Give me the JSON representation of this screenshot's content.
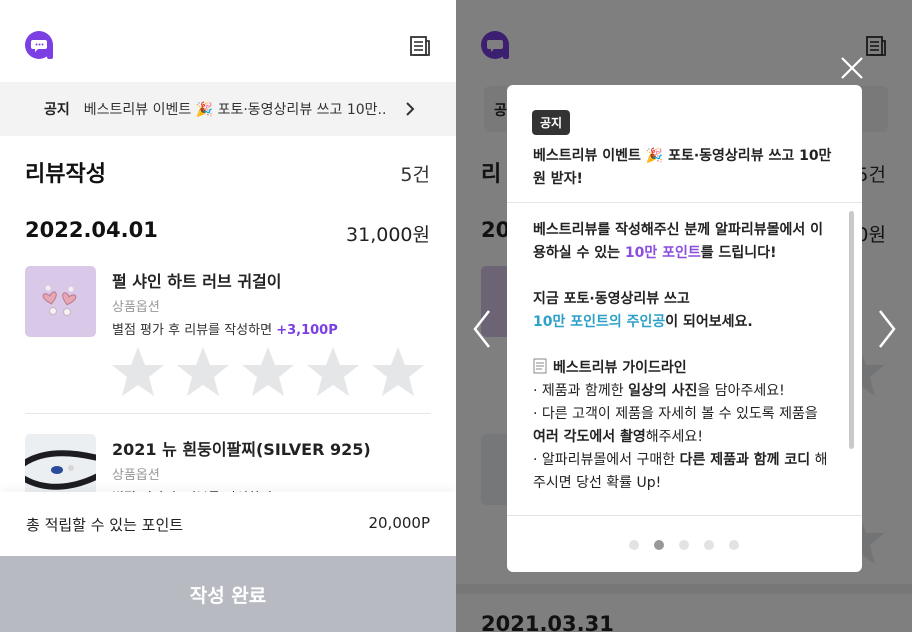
{
  "app": {
    "logo_icon": "alpha-chat-logo-icon",
    "brand_color": "#7b3fe4",
    "doc_icon": "document-list-icon"
  },
  "notice": {
    "tag": "공지",
    "text": "베스트리뷰 이벤트 🎉 포토·동영상리뷰 쓰고 10만..",
    "chevron_icon": "chevron-right-icon"
  },
  "review": {
    "title": "리뷰작성",
    "count": "5건"
  },
  "order": {
    "date": "2022.04.01",
    "price": "31,000원"
  },
  "products": [
    {
      "name": "펄 샤인 하트 러브 귀걸이",
      "option": "상품옵션",
      "note_prefix": "별점 평가 후 리뷰를 작성하면 ",
      "note_points": "+3,100P",
      "rating": 0,
      "max_rating": 5
    },
    {
      "name": "2021 뉴 흰둥이팔찌(SILVER 925)",
      "option": "상품옵션",
      "note_prefix": "별점 평가 후 리뷰를 작성하면",
      "note_points": "",
      "rating": 0,
      "max_rating": 5
    }
  ],
  "points": {
    "label": "총 적립할 수 있는 포인트",
    "value": "20,000P"
  },
  "submit": {
    "label": "작성 완료",
    "color": "#b7bac0"
  },
  "right_bg": {
    "notice_tag": "공",
    "review_initial": "리",
    "count_partial": "5건",
    "date_partial": "20",
    "price_partial": "0원",
    "next_date": "2021.03.31"
  },
  "modal": {
    "tag": "공지",
    "title": "베스트리뷰 이벤트 🎉 포토·동영상리뷰 쓰고 10만원 받자!",
    "body": {
      "l1a": "베스트리뷰를 작성해주신 분께 알파리뷰몰에서 이용하실 수 있는 ",
      "l1b": "10만 포인트",
      "l1c": "를 드립니다!",
      "l2a": "지금 포토·동영상리뷰 쓰고",
      "l2b": "10만 포인트의 주인공",
      "l2c": "이 되어보세요.",
      "guide_icon": "memo-icon",
      "guide_title": "베스트리뷰 가이드라인",
      "g1a": "· 제품과 함께한 ",
      "g1b": "일상의 사진",
      "g1c": "을 담아주세요!",
      "g2a": "· 다른 고객이 제품을 자세히 볼 수 있도록 제품을 ",
      "g2b": "여러 각도에서 촬영",
      "g2c": "해주세요!",
      "g3a": "· 알파리뷰몰에서 구매한 ",
      "g3b": "다른 제품과 함께 코디",
      "g3c": " 해주시면 당선 확률 Up!"
    },
    "pagination": {
      "total": 5,
      "current": 2
    },
    "close_icon": "close-icon",
    "prev_icon": "chevron-left-icon",
    "next_icon": "chevron-right-icon"
  }
}
